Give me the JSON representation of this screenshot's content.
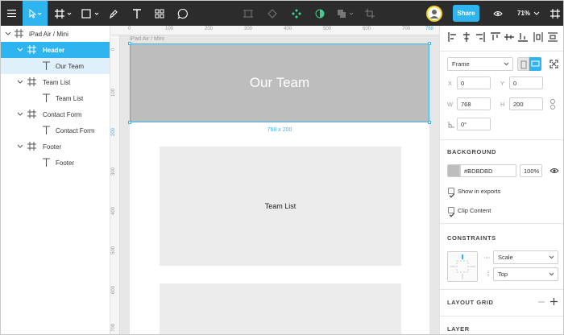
{
  "toolbar": {
    "share_label": "Share",
    "zoom_label": "71%",
    "avatar_color": "#f2d024",
    "accent_color": "#2eb4ef"
  },
  "layers": {
    "items": [
      {
        "label": "iPad Air / Mini",
        "type": "frame",
        "state": "normal"
      },
      {
        "label": "Header",
        "type": "frame",
        "state": "selected"
      },
      {
        "label": "Our Team",
        "type": "text",
        "state": "subselected"
      },
      {
        "label": "Team List",
        "type": "frame",
        "state": "normal"
      },
      {
        "label": "Team List",
        "type": "text",
        "state": "normal"
      },
      {
        "label": "Contact Form",
        "type": "frame",
        "state": "normal"
      },
      {
        "label": "Contact Form",
        "type": "text",
        "state": "normal"
      },
      {
        "label": "Footer",
        "type": "frame",
        "state": "normal"
      },
      {
        "label": "Footer",
        "type": "text",
        "state": "normal"
      }
    ]
  },
  "canvas": {
    "ruler_top": [
      "0",
      "100",
      "200",
      "300",
      "400",
      "500",
      "600",
      "700",
      "768"
    ],
    "ruler_left": [
      "0",
      "100",
      "200",
      "300",
      "400",
      "500",
      "600",
      "700"
    ],
    "frame_label": "iPad Air / Mini",
    "header_text": "Our Team",
    "header_color": "#bdbdbd",
    "selection_size": "768 x 200",
    "teamlist_text": "Team List"
  },
  "props": {
    "frame_preset": "Frame",
    "x_label": "X",
    "x_value": "0",
    "y_label": "Y",
    "y_value": "0",
    "w_label": "W",
    "w_value": "768",
    "h_label": "H",
    "h_value": "200",
    "rotation_value": "0°",
    "background_title": "BACKGROUND",
    "bg_hex": "#BDBDBD",
    "bg_opacity": "100%",
    "show_in_exports_label": "Show in exports",
    "clip_content_label": "Clip Content",
    "constraints_title": "CONSTRAINTS",
    "constraint_h": "Scale",
    "constraint_v": "Top",
    "layout_grid_title": "LAYOUT GRID",
    "layer_title": "LAYER"
  }
}
